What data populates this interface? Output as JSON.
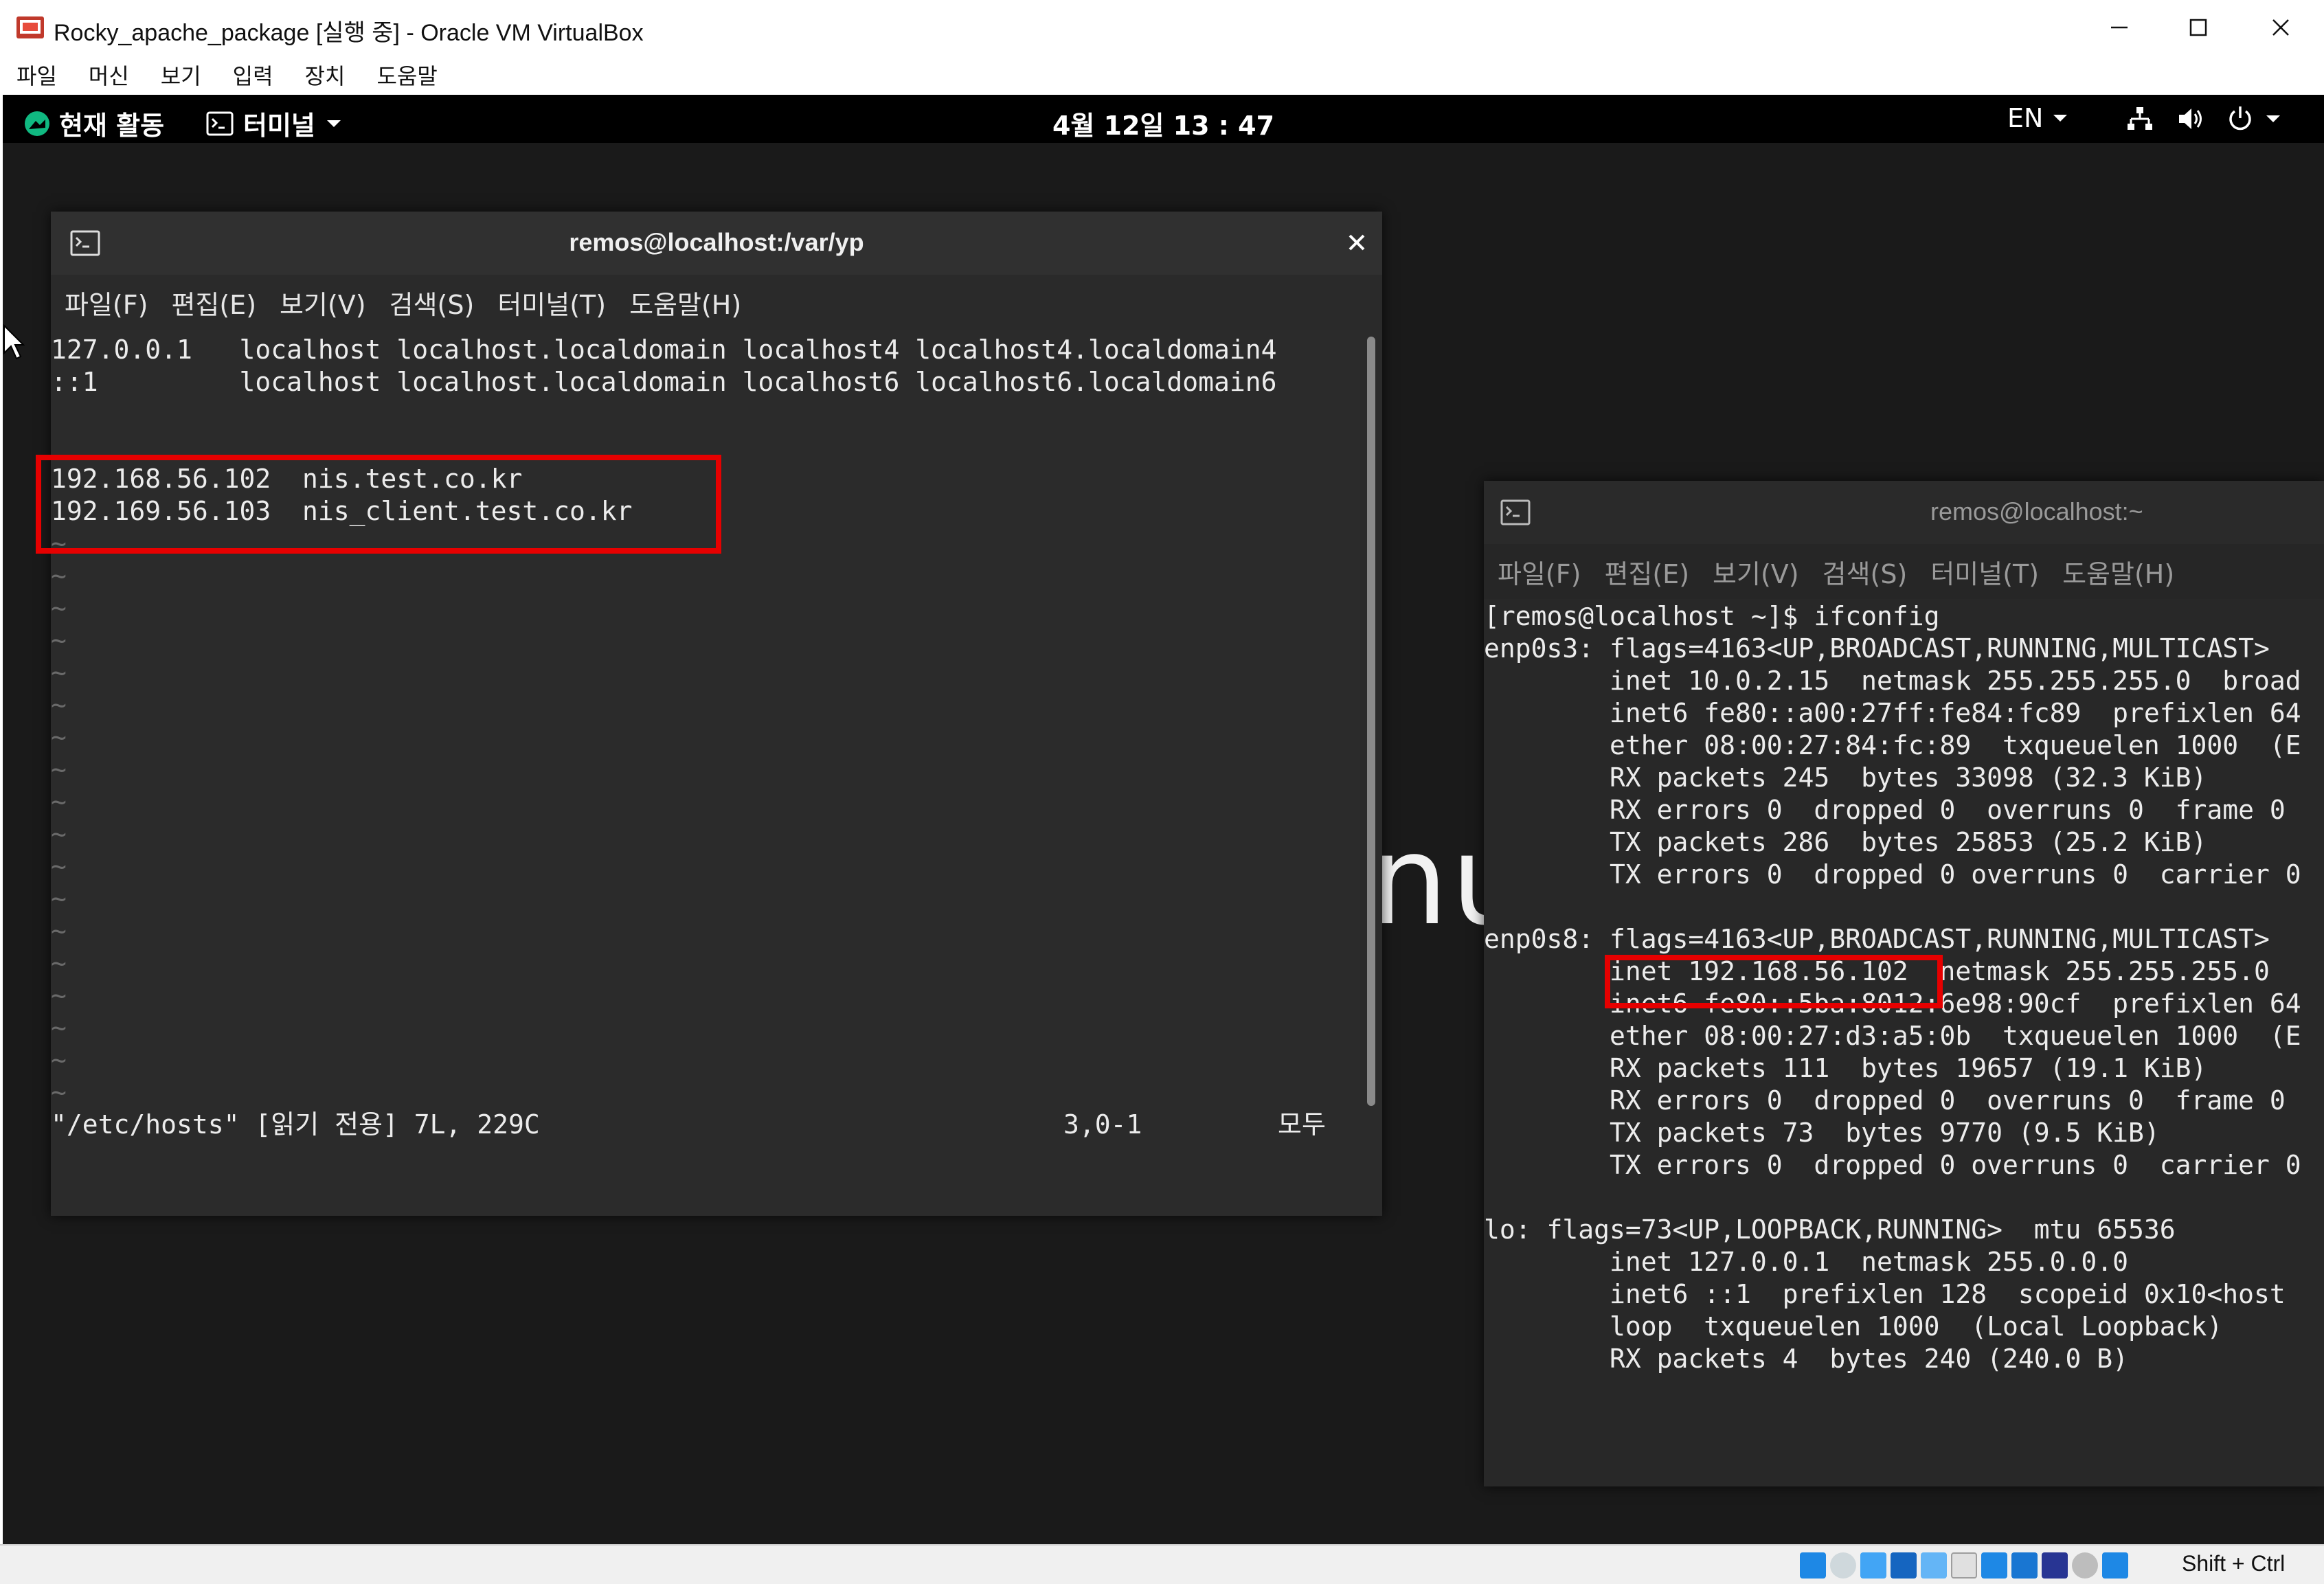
{
  "host_window": {
    "title": "Rocky_apache_package [실행 중] - Oracle VM VirtualBox",
    "menu": [
      "파일",
      "머신",
      "보기",
      "입력",
      "장치",
      "도움말"
    ],
    "host_key": "Shift + Ctrl"
  },
  "gnome_bar": {
    "activities": "현재 활동",
    "app_menu": "터미널",
    "clock": "4월 12일 13 : 47",
    "language": "EN"
  },
  "desktop": {
    "logo_fragment": "nux"
  },
  "terminal_hosts": {
    "title": "remos@localhost:/var/yp",
    "menu": [
      "파일(F)",
      "편집(E)",
      "보기(V)",
      "검색(S)",
      "터미널(T)",
      "도움말(H)"
    ],
    "lines": [
      "127.0.0.1   localhost localhost.localdomain localhost4 localhost4.localdomain4",
      "::1         localhost localhost.localdomain localhost6 localhost6.localdomain6",
      "",
      "",
      "192.168.56.102  nis.test.co.kr",
      "192.169.56.103  nis_client.test.co.kr"
    ],
    "tilde": "~",
    "status_left": "\"/etc/hosts\" [읽기 전용] 7L, 229C",
    "status_pos": "3,0-1",
    "status_right": "모두"
  },
  "terminal_ifconfig": {
    "title": "remos@localhost:~",
    "menu": [
      "파일(F)",
      "편집(E)",
      "보기(V)",
      "검색(S)",
      "터미널(T)",
      "도움말(H)"
    ],
    "lines": [
      "[remos@localhost ~]$ ifconfig",
      "enp0s3: flags=4163<UP,BROADCAST,RUNNING,MULTICAST>",
      "        inet 10.0.2.15  netmask 255.255.255.0  broad",
      "        inet6 fe80::a00:27ff:fe84:fc89  prefixlen 64",
      "        ether 08:00:27:84:fc:89  txqueuelen 1000  (E",
      "        RX packets 245  bytes 33098 (32.3 KiB)",
      "        RX errors 0  dropped 0  overruns 0  frame 0",
      "        TX packets 286  bytes 25853 (25.2 KiB)",
      "        TX errors 0  dropped 0 overruns 0  carrier 0",
      "",
      "enp0s8: flags=4163<UP,BROADCAST,RUNNING,MULTICAST>",
      "        inet 192.168.56.102  netmask 255.255.255.0",
      "        inet6 fe80::5ba:8012:6e98:90cf  prefixlen 64",
      "        ether 08:00:27:d3:a5:0b  txqueuelen 1000  (E",
      "        RX packets 111  bytes 19657 (19.1 KiB)",
      "        RX errors 0  dropped 0  overruns 0  frame 0",
      "        TX packets 73  bytes 9770 (9.5 KiB)",
      "        TX errors 0  dropped 0 overruns 0  carrier 0",
      "",
      "lo: flags=73<UP,LOOPBACK,RUNNING>  mtu 65536",
      "        inet 127.0.0.1  netmask 255.0.0.0",
      "        inet6 ::1  prefixlen 128  scopeid 0x10<host",
      "        loop  txqueuelen 1000  (Local Loopback)",
      "        RX packets 4  bytes 240 (240.0 B)"
    ]
  },
  "colors": {
    "highlight": "#e60000",
    "terminal_bg": "#2b2b2b",
    "panel": "#000000"
  }
}
